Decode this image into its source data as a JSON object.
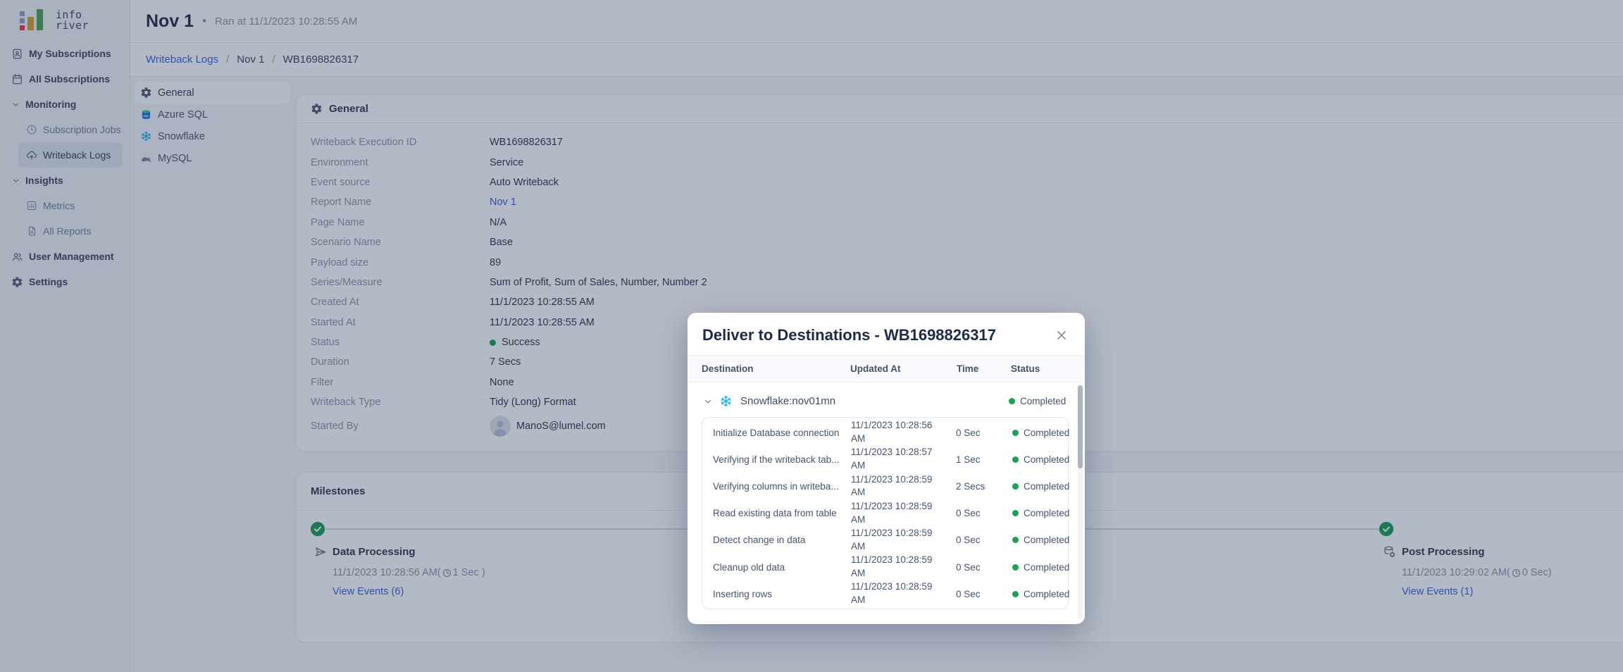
{
  "brand": {
    "line1": "info",
    "line2": "river"
  },
  "header": {
    "title": "Nov 1",
    "separator": "•",
    "subtitle": "Ran at 11/1/2023 10:28:55 AM"
  },
  "breadcrumb": {
    "separator": "/",
    "items": [
      {
        "label": "Writeback Logs",
        "link": true
      },
      {
        "label": "Nov 1",
        "link": false
      },
      {
        "label": "WB1698826317",
        "link": false
      }
    ]
  },
  "sidebar": {
    "items": [
      {
        "label": "My Subscriptions",
        "icon": "badge-icon",
        "type": "top",
        "selected": false
      },
      {
        "label": "All Subscriptions",
        "icon": "calendar-icon",
        "type": "top",
        "selected": false
      },
      {
        "label": "Monitoring",
        "icon": "chevron-down-icon",
        "type": "group",
        "selected": false
      },
      {
        "label": "Subscription Jobs",
        "icon": "clock-icon",
        "type": "sub",
        "selected": false
      },
      {
        "label": "Writeback Logs",
        "icon": "cloud-upload-icon",
        "type": "sub",
        "selected": true
      },
      {
        "label": "Insights",
        "icon": "chevron-down-icon",
        "type": "group",
        "selected": false
      },
      {
        "label": "Metrics",
        "icon": "metrics-icon",
        "type": "sub",
        "selected": false
      },
      {
        "label": "All Reports",
        "icon": "report-icon",
        "type": "sub",
        "selected": false
      },
      {
        "label": "User Management",
        "icon": "users-icon",
        "type": "top",
        "selected": false
      },
      {
        "label": "Settings",
        "icon": "gear-icon",
        "type": "top",
        "selected": false
      }
    ]
  },
  "subnav": {
    "items": [
      {
        "label": "General",
        "icon": "gear-icon",
        "selected": true
      },
      {
        "label": "Azure SQL",
        "icon": "azure-sql-icon",
        "selected": false
      },
      {
        "label": "Snowflake",
        "icon": "snowflake-icon",
        "selected": false
      },
      {
        "label": "MySQL",
        "icon": "mysql-icon",
        "selected": false
      }
    ]
  },
  "general": {
    "title": "General",
    "fields": [
      {
        "label": "Writeback Execution ID",
        "value": "WB1698826317"
      },
      {
        "label": "Environment",
        "value": "Service"
      },
      {
        "label": "Event source",
        "value": "Auto Writeback"
      },
      {
        "label": "Report Name",
        "value": "Nov 1",
        "link": true
      },
      {
        "label": "Page Name",
        "value": "N/A"
      },
      {
        "label": "Scenario Name",
        "value": "Base"
      },
      {
        "label": "Payload size",
        "value": "89"
      },
      {
        "label": "Series/Measure",
        "value": "Sum of Profit, Sum of Sales, Number, Number 2"
      },
      {
        "label": "Created At",
        "value": "11/1/2023 10:28:55 AM"
      },
      {
        "label": "Started At",
        "value": "11/1/2023 10:28:55 AM"
      },
      {
        "label": "Status",
        "value": "Success",
        "status": "success"
      },
      {
        "label": "Duration",
        "value": "7 Secs"
      },
      {
        "label": "Filter",
        "value": "None"
      },
      {
        "label": "Writeback Type",
        "value": "Tidy (Long) Format"
      },
      {
        "label": "Started By",
        "value": "ManoS@lumel.com",
        "avatar": true
      }
    ]
  },
  "milestones": {
    "title": "Milestones",
    "items": [
      {
        "name": "Data Processing",
        "icon": "send-icon",
        "timestamp_prefix": "11/1/2023 10:28:56 AM(",
        "duration": "1 Sec )",
        "view_events": "View Events (6)"
      },
      {
        "name": "Post Processing",
        "icon": "database-gear-icon",
        "timestamp_prefix": "11/1/2023 10:29:02 AM(",
        "duration": "0 Sec)",
        "view_events": "View Events (1)"
      }
    ]
  },
  "modal": {
    "title": "Deliver to Destinations - WB1698826317",
    "columns": [
      "Destination",
      "Updated At",
      "Time",
      "Status"
    ],
    "group": {
      "name": "Snowflake:nov01mn",
      "status": "Completed",
      "icon": "snowflake-icon"
    },
    "steps": [
      {
        "name": "Initialize Database connection",
        "updated_at": "11/1/2023 10:28:56 AM",
        "time": "0 Sec",
        "status": "Completed"
      },
      {
        "name": "Verifying if the writeback tab...",
        "updated_at": "11/1/2023 10:28:57 AM",
        "time": "1 Sec",
        "status": "Completed"
      },
      {
        "name": "Verifying columns in writeba...",
        "updated_at": "11/1/2023 10:28:59 AM",
        "time": "2 Secs",
        "status": "Completed"
      },
      {
        "name": "Read existing data from table",
        "updated_at": "11/1/2023 10:28:59 AM",
        "time": "0 Sec",
        "status": "Completed"
      },
      {
        "name": "Detect change in data",
        "updated_at": "11/1/2023 10:28:59 AM",
        "time": "0 Sec",
        "status": "Completed"
      },
      {
        "name": "Cleanup old data",
        "updated_at": "11/1/2023 10:28:59 AM",
        "time": "0 Sec",
        "status": "Completed"
      },
      {
        "name": "Inserting rows",
        "updated_at": "11/1/2023 10:28:59 AM",
        "time": "0 Sec",
        "status": "Completed"
      }
    ]
  },
  "colors": {
    "accent_blue": "#3d63dd",
    "success_green": "#18a34e",
    "milestone_green": "#1f9f5c",
    "snowflake_blue": "#29b5e8",
    "azure_blue": "#1374d4"
  }
}
